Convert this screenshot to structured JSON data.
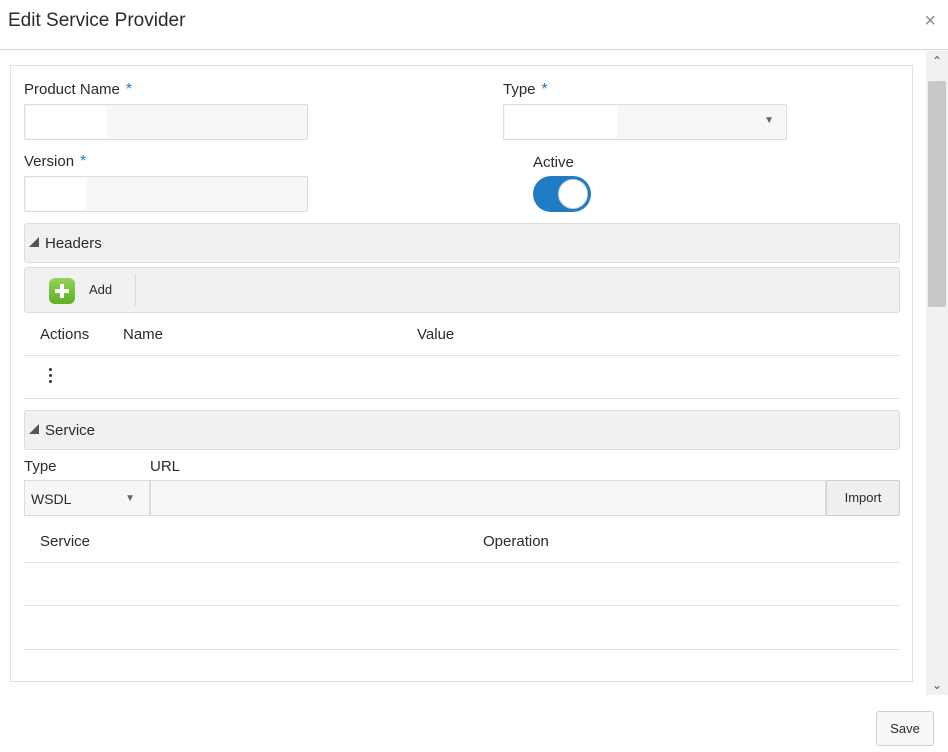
{
  "dialog": {
    "title": "Edit Service Provider",
    "close_glyph": "×"
  },
  "form": {
    "product_name_label": "Product Name",
    "type_label": "Type",
    "version_label": "Version",
    "active_label": "Active",
    "required_marker": "*",
    "active_on": true,
    "select_caret": "▼"
  },
  "headers_section": {
    "title": "Headers",
    "add_label": "Add",
    "columns": [
      "Actions",
      "Name",
      "Value"
    ]
  },
  "service_section": {
    "title": "Service",
    "type_label": "Type",
    "url_label": "URL",
    "type_value": "WSDL",
    "url_value": "",
    "import_label": "Import",
    "columns": [
      "Service",
      "Operation"
    ]
  },
  "footer": {
    "save_label": "Save"
  },
  "scrollbar": {
    "up": "⌃",
    "down": "⌄"
  },
  "colors": {
    "accent": "#1f7bc3",
    "add_green": "#6fbf3a"
  }
}
